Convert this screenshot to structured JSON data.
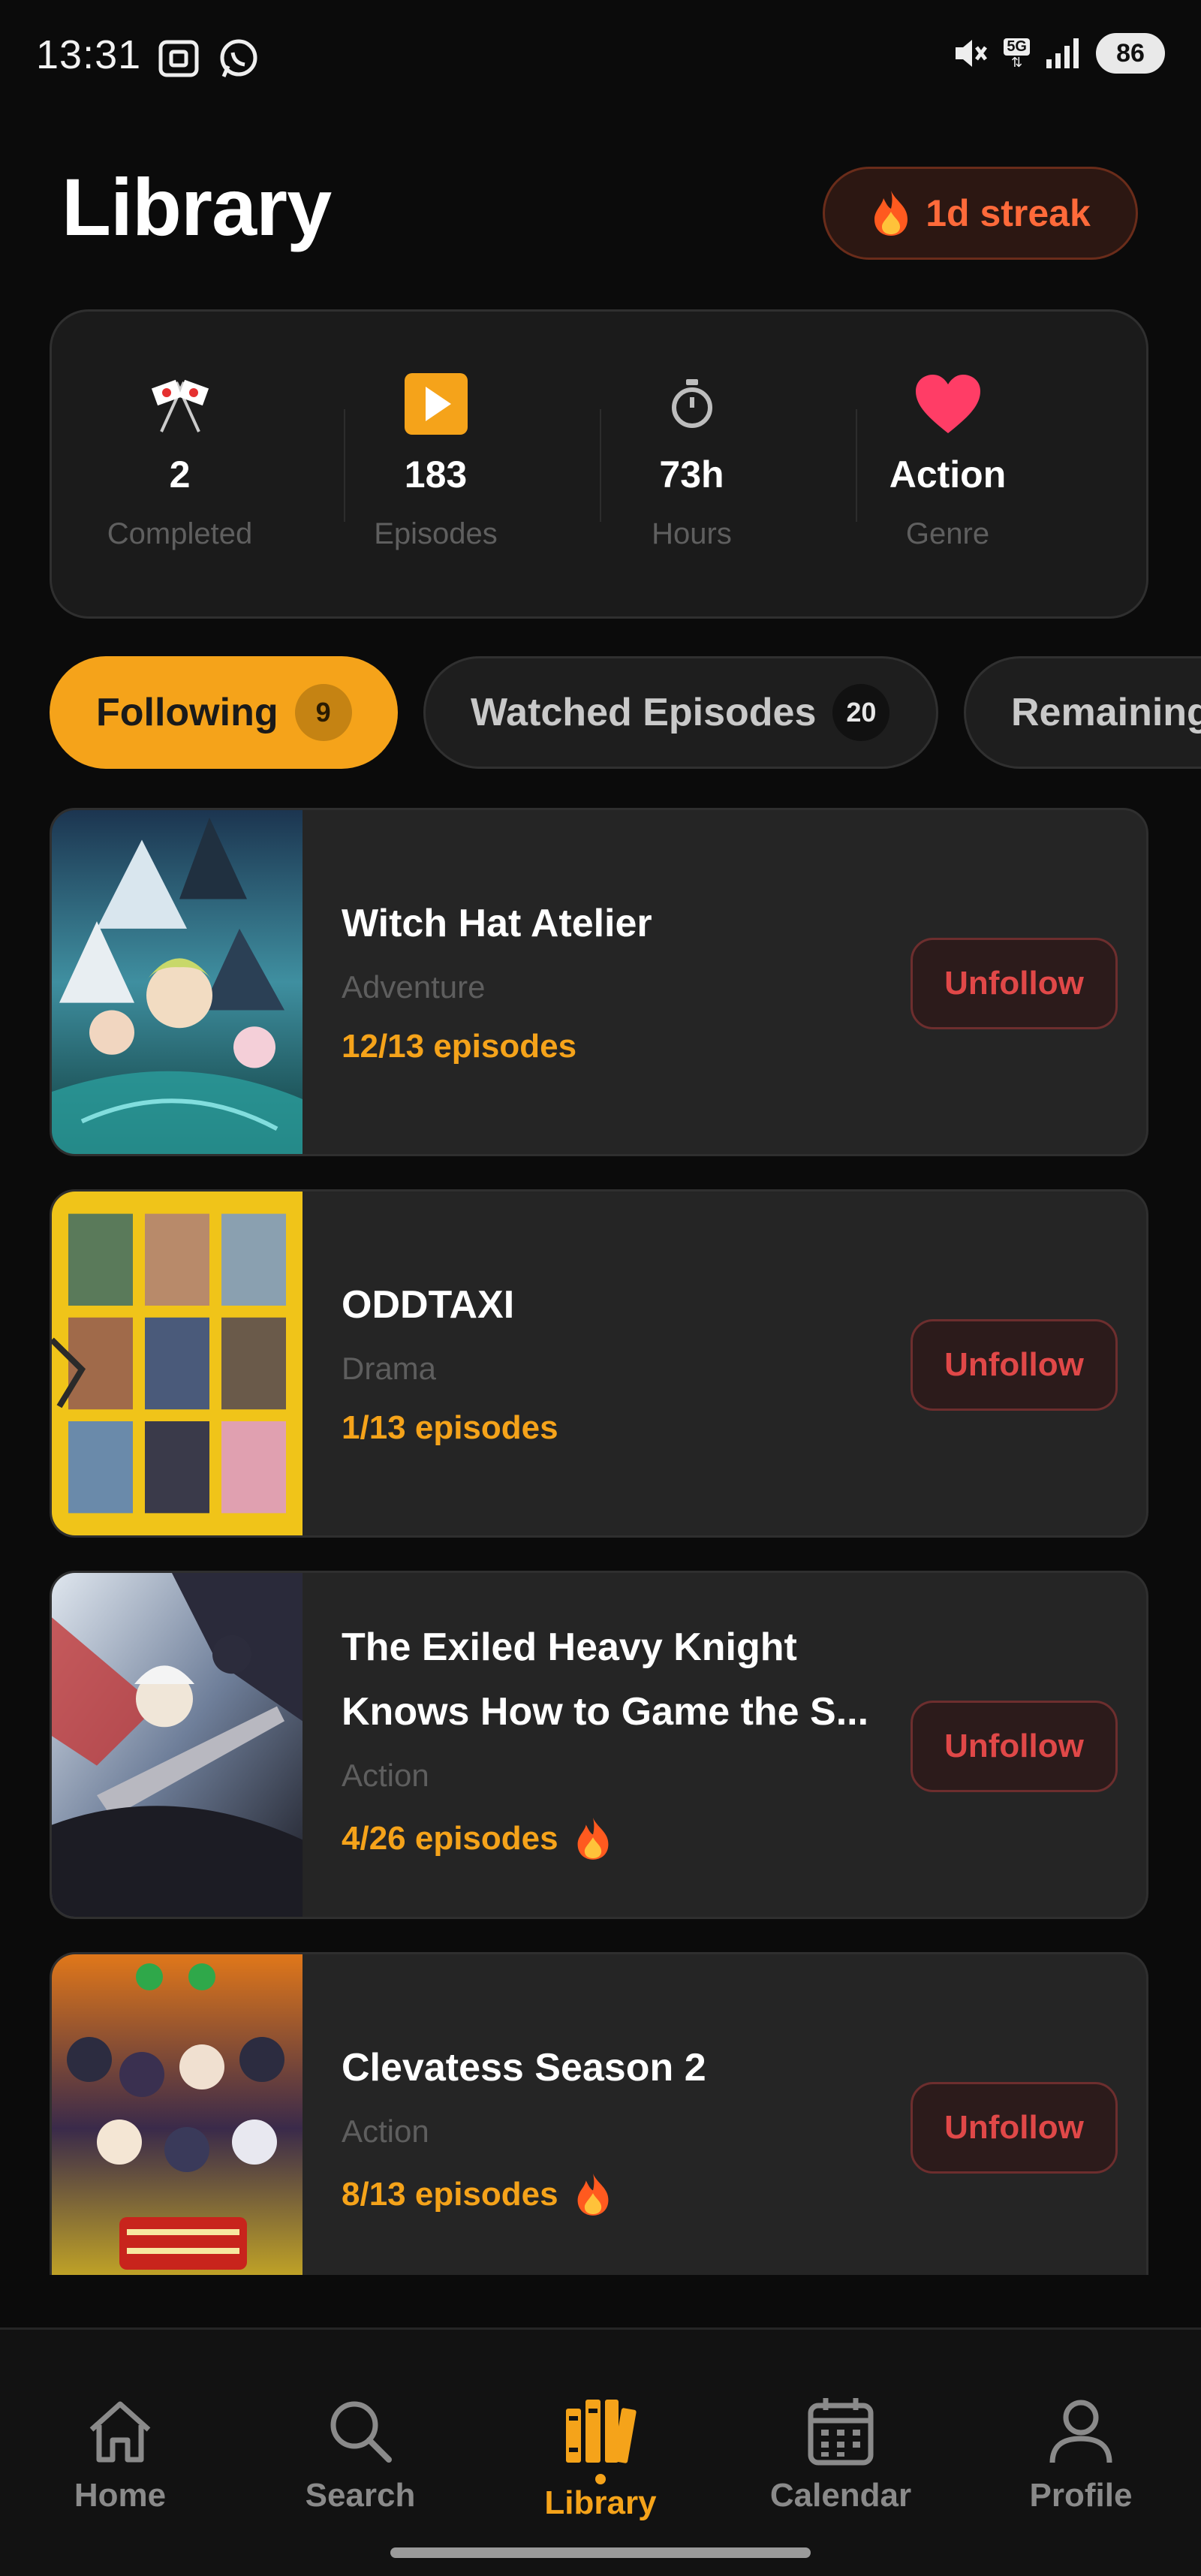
{
  "status_bar": {
    "time": "13:31",
    "battery": "86",
    "network": "5G"
  },
  "header": {
    "title": "Library",
    "streak_label": "1d streak",
    "streak_icon": "fire-icon"
  },
  "stats": [
    {
      "icon": "crossed-flags-icon",
      "value": "2",
      "label": "Completed"
    },
    {
      "icon": "play-button-icon",
      "value": "183",
      "label": "Episodes"
    },
    {
      "icon": "stopwatch-icon",
      "value": "73h",
      "label": "Hours"
    },
    {
      "icon": "heart-icon",
      "value": "Action",
      "label": "Genre"
    }
  ],
  "tabs": [
    {
      "label": "Following",
      "count": "9",
      "active": true
    },
    {
      "label": "Watched Episodes",
      "count": "20",
      "active": false
    },
    {
      "label": "Remaining",
      "count": "",
      "active": false
    }
  ],
  "anime_list": [
    {
      "title": "Witch Hat Atelier",
      "genre": "Adventure",
      "progress": "12/13 episodes",
      "hot": false,
      "action": "Unfollow"
    },
    {
      "title": "ODDTAXI",
      "genre": "Drama",
      "progress": "1/13 episodes",
      "hot": false,
      "action": "Unfollow"
    },
    {
      "title": "The Exiled Heavy Knight Knows How to Game the S...",
      "genre": "Action",
      "progress": "4/26 episodes",
      "hot": true,
      "action": "Unfollow"
    },
    {
      "title": "Clevatess Season 2",
      "genre": "Action",
      "progress": "8/13 episodes",
      "hot": true,
      "action": "Unfollow"
    }
  ],
  "bottom_nav": [
    {
      "label": "Home",
      "icon": "home-icon",
      "active": false
    },
    {
      "label": "Search",
      "icon": "search-icon",
      "active": false
    },
    {
      "label": "Library",
      "icon": "library-icon",
      "active": true
    },
    {
      "label": "Calendar",
      "icon": "calendar-icon",
      "active": false
    },
    {
      "label": "Profile",
      "icon": "profile-icon",
      "active": false
    }
  ],
  "colors": {
    "accent": "#f5a31a",
    "danger": "#e04848",
    "streak": "#ff6a3a",
    "background": "#0b0b0b",
    "card": "#252525"
  }
}
